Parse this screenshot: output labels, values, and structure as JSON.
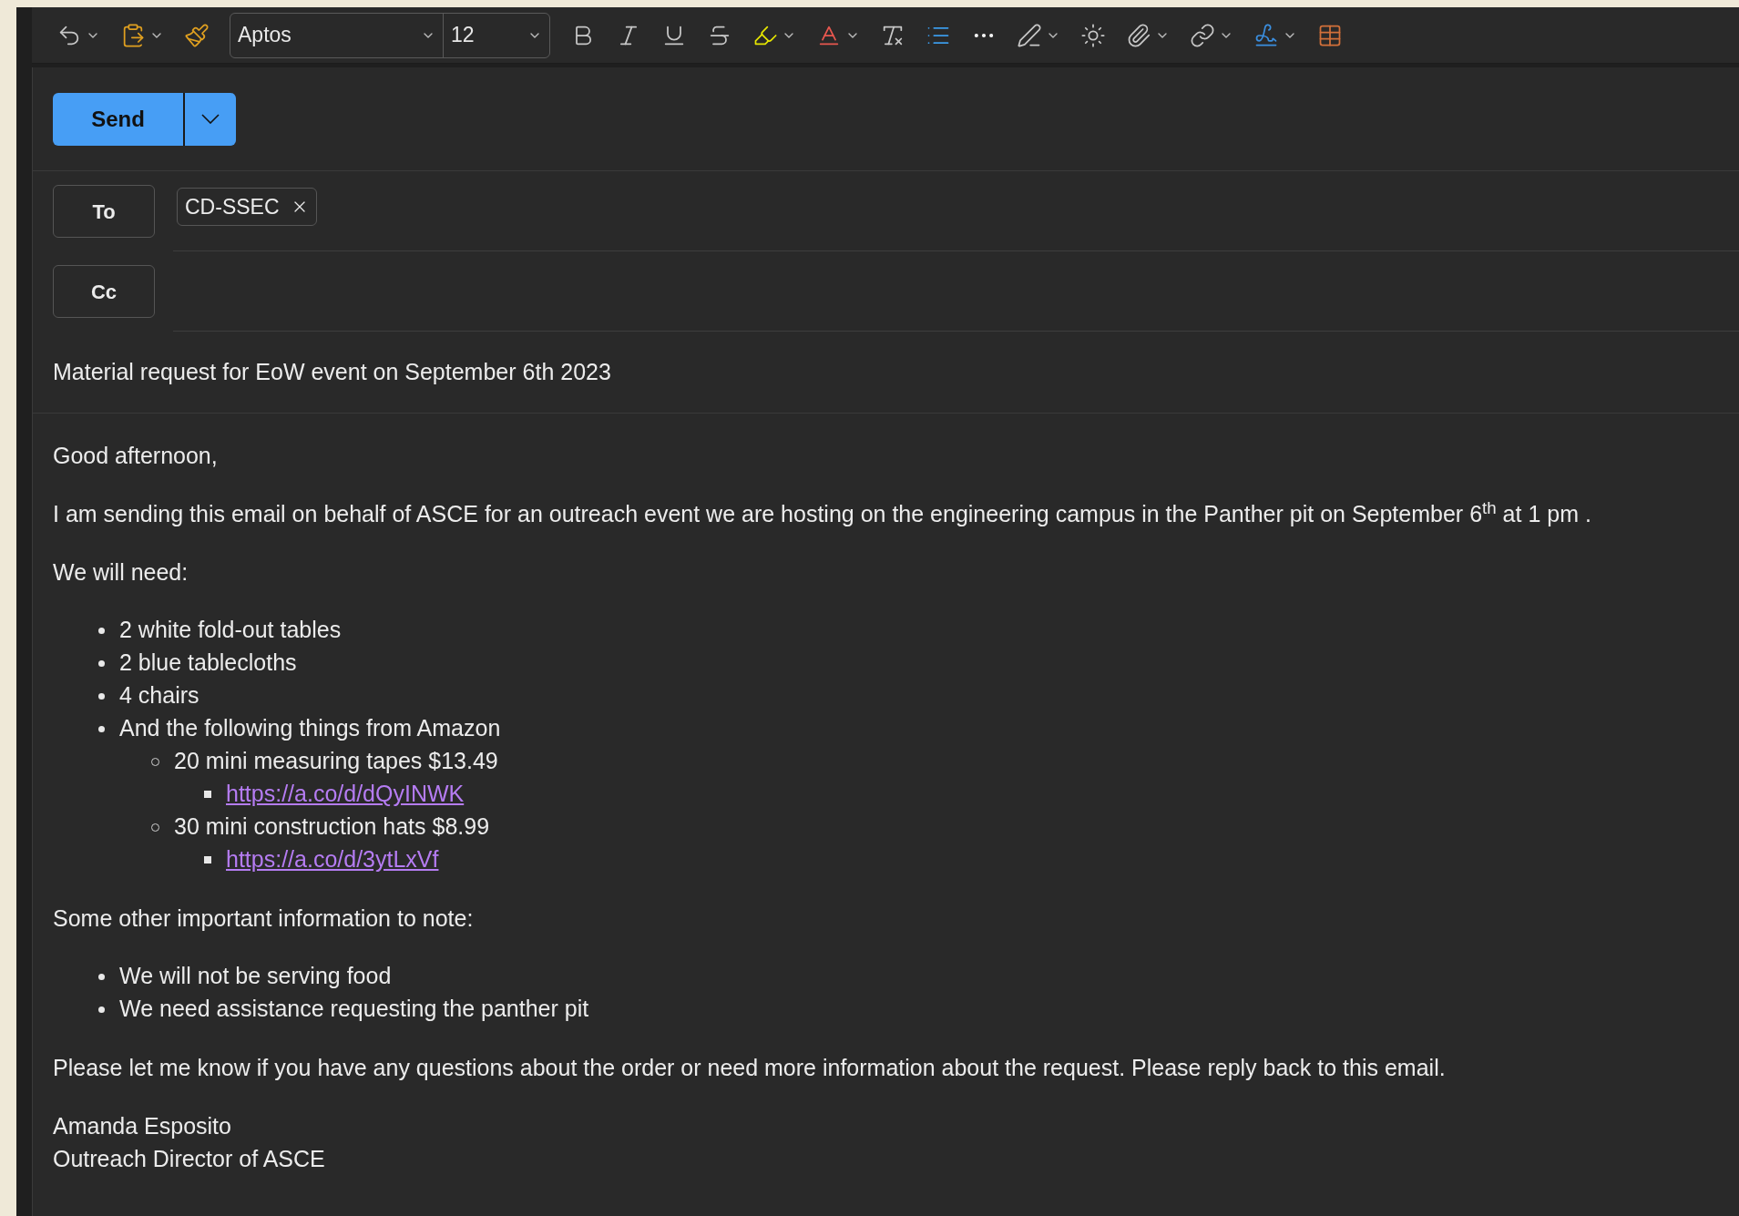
{
  "toolbar": {
    "font_name": "Aptos",
    "font_size": "12"
  },
  "send": {
    "label": "Send"
  },
  "to": {
    "label": "To",
    "recipients": [
      "CD-SSEC"
    ]
  },
  "cc": {
    "label": "Cc"
  },
  "subject": "Material request for EoW event on September 6th 2023",
  "body": [
    {
      "kind": "paragraph",
      "text": "Good afternoon,"
    },
    {
      "kind": "paragraph",
      "text": "I am sending this email on behalf of ASCE for an outreach event we are hosting on the engineering campus in the Panther pit on September 6$^{th}$ at 1 pm ."
    },
    {
      "kind": "paragraph",
      "text": "We will need:"
    },
    {
      "kind": "list",
      "items": [
        {
          "kind": "text",
          "text": "2 white fold-out tables"
        },
        {
          "kind": "text",
          "text": "2 blue tablecloths"
        },
        {
          "kind": "text",
          "text": "4 chairs"
        },
        {
          "kind": "text",
          "text": "And the following things from Amazon",
          "children": [
            {
              "kind": "text",
              "text": "20 mini measuring tapes $13.49",
              "children": [
                {
                  "kind": "link",
                  "text": "https://a.co/d/dQyINWK"
                }
              ]
            },
            {
              "kind": "text",
              "text": "30 mini construction hats $8.99",
              "children": [
                {
                  "kind": "link",
                  "text": "https://a.co/d/3ytLxVf"
                }
              ]
            }
          ]
        }
      ]
    },
    {
      "kind": "paragraph",
      "text": "Some other important information to note:"
    },
    {
      "kind": "list",
      "items": [
        {
          "kind": "text",
          "text": "We will not be serving food"
        },
        {
          "kind": "text",
          "text": "We need assistance requesting the panther pit"
        }
      ]
    },
    {
      "kind": "paragraph",
      "text": "Please let me know if you have any questions about the order or need more information about the request. Please reply back to this email."
    },
    {
      "kind": "lines",
      "lines": [
        "Amanda Esposito",
        "Outreach Director of ASCE"
      ]
    }
  ]
}
